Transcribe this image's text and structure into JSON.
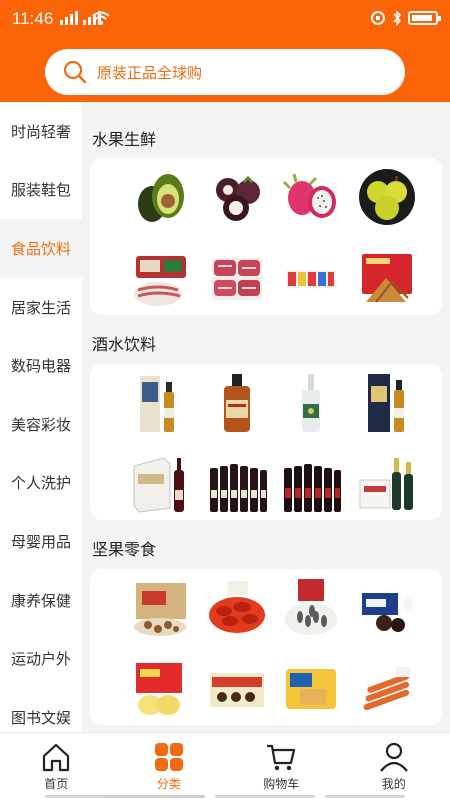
{
  "status": {
    "time": "11:46"
  },
  "search": {
    "placeholder": "原装正品全球购"
  },
  "sidebar": {
    "items": [
      {
        "label": "时尚轻奢"
      },
      {
        "label": "服装鞋包"
      },
      {
        "label": "食品饮料",
        "active": true
      },
      {
        "label": "居家生活"
      },
      {
        "label": "数码电器"
      },
      {
        "label": "美容彩妆"
      },
      {
        "label": "个人洗护"
      },
      {
        "label": "母婴用品"
      },
      {
        "label": "康养保健"
      },
      {
        "label": "运动户外"
      },
      {
        "label": "图书文娱"
      }
    ]
  },
  "sections": [
    {
      "title": "水果生鲜",
      "products": [
        "avocado",
        "mangosteen",
        "dragon-fruit",
        "pear",
        "bacon",
        "beef-steak",
        "yogurt-drinks",
        "zongzi"
      ]
    },
    {
      "title": "酒水饮料",
      "products": [
        "whisky-box",
        "whisky-bottle",
        "rum-bottle",
        "whisky-dark-box",
        "wine-box",
        "wine-set-6",
        "wine-set-6-red",
        "champagne-set"
      ]
    },
    {
      "title": "坚果零食",
      "products": [
        "nut-gift-box",
        "crayfish",
        "sunflower-seeds",
        "chocolate-cookies",
        "egg-cake",
        "snack-box",
        "biscuits",
        "jerky-strips"
      ]
    }
  ],
  "tabbar": {
    "items": [
      {
        "label": "首页"
      },
      {
        "label": "分类",
        "active": true
      },
      {
        "label": "购物车"
      },
      {
        "label": "我的"
      }
    ]
  },
  "colors": {
    "accent": "#fb6508",
    "active_text": "#f26b12"
  }
}
